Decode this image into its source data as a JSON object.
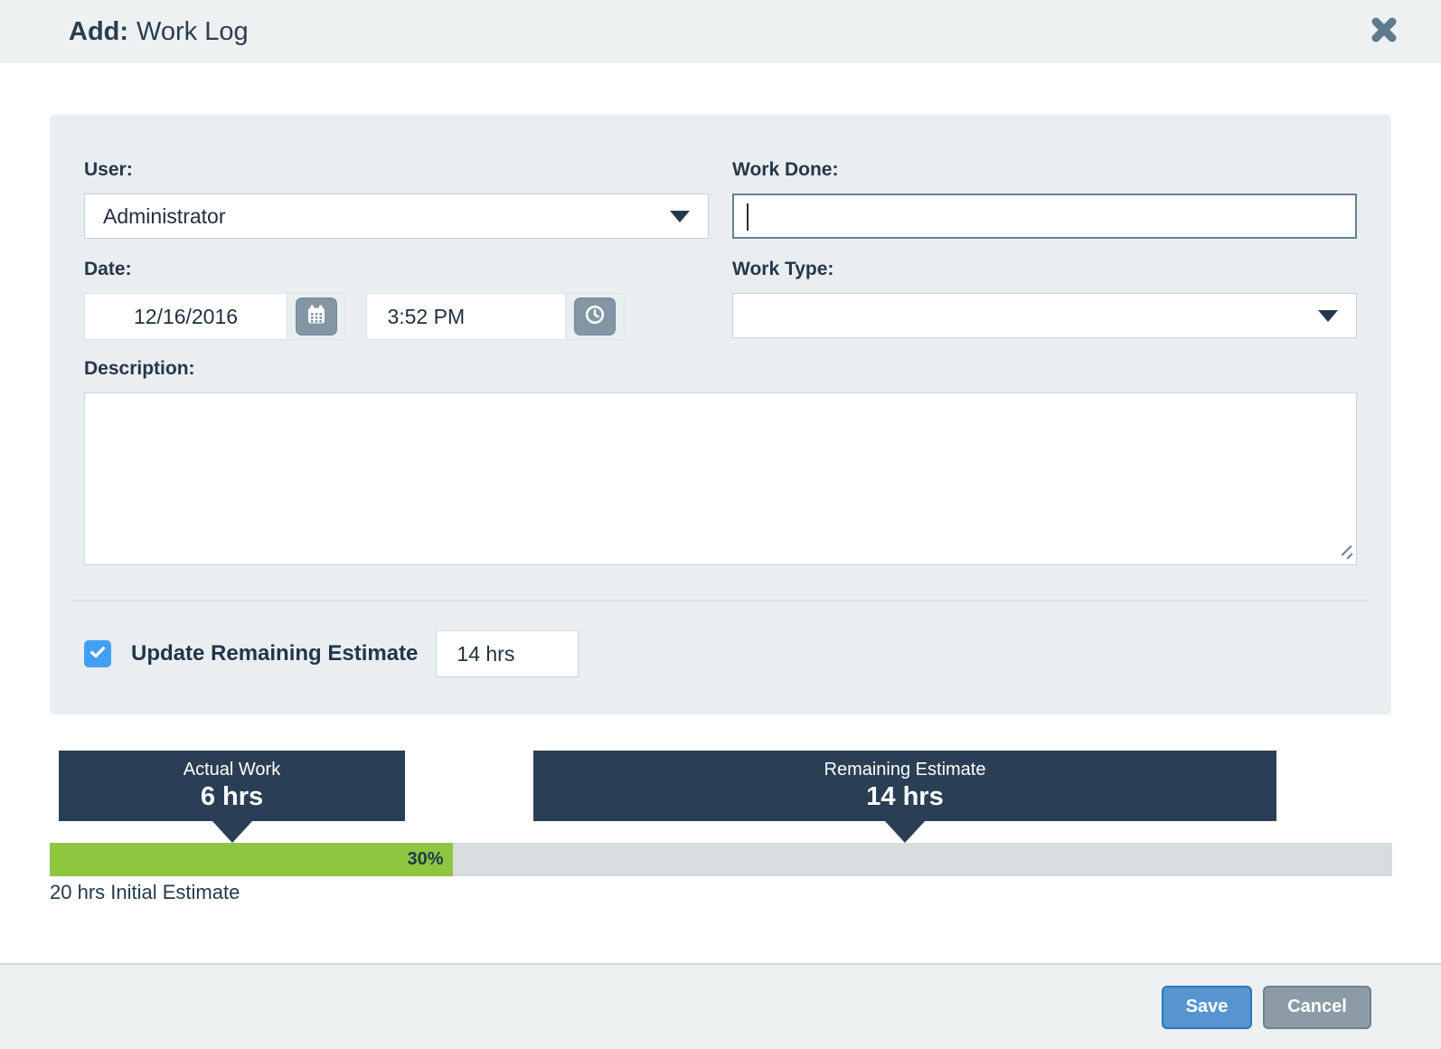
{
  "header": {
    "title_prefix": "Add:",
    "title": "Work Log",
    "close_icon": "close-x"
  },
  "form": {
    "user": {
      "label": "User:",
      "value": "Administrator"
    },
    "work_done": {
      "label": "Work Done:",
      "value": "",
      "focused": true
    },
    "date": {
      "label": "Date:",
      "date_value": "12/16/2016",
      "time_value": "3:52 PM",
      "date_icon": "calendar-icon",
      "time_icon": "clock-icon"
    },
    "work_type": {
      "label": "Work Type:",
      "value": ""
    },
    "description": {
      "label": "Description:",
      "value": ""
    },
    "update_remaining": {
      "label": "Update Remaining Estimate",
      "checked": true,
      "value": "14 hrs"
    }
  },
  "progress": {
    "actual": {
      "label": "Actual Work",
      "value": "6 hrs",
      "hours": 6
    },
    "remaining": {
      "label": "Remaining Estimate",
      "value": "14 hrs",
      "hours": 14
    },
    "percent": 30,
    "percent_label": "30%",
    "caption": "20 hrs Initial Estimate",
    "initial_estimate_hours": 20
  },
  "footer": {
    "save_label": "Save",
    "cancel_label": "Cancel"
  },
  "colors": {
    "accent_green": "#8dc63f",
    "navy_callout": "#2a3f55",
    "checkbox_blue": "#41a0f4",
    "save_blue": "#5795d0",
    "cancel_gray": "#8c9ba5",
    "header_bg": "#edf1f2",
    "panel_bg": "#eaeef0",
    "track_gray": "#d8dedf"
  }
}
